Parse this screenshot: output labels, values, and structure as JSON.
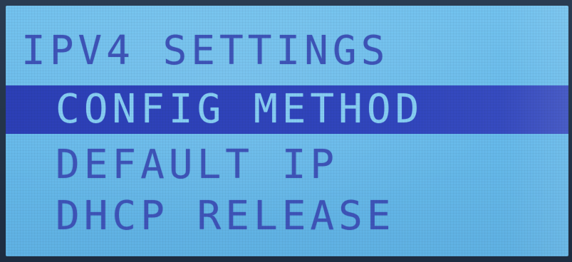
{
  "screen": {
    "title": "IPV4 SETTINGS",
    "menu": [
      {
        "label": "CONFIG METHOD",
        "selected": true
      },
      {
        "label": "DEFAULT IP",
        "selected": false
      },
      {
        "label": "DHCP RELEASE",
        "selected": false
      }
    ]
  },
  "colors": {
    "lcd_background": "#6bbcec",
    "text": "#3e54b8",
    "highlight_bar": "#3146bd",
    "highlight_text": "#86cdf2"
  }
}
